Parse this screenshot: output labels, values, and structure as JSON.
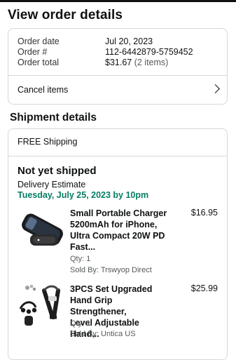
{
  "page": {
    "title": "View order details"
  },
  "order": {
    "date_label": "Order date",
    "date_value": "Jul 20, 2023",
    "number_label": "Order #",
    "number_value": "112-6442879-5759452",
    "total_label": "Order total",
    "total_value": "$31.67",
    "total_items": "(2 items)",
    "cancel_label": "Cancel items"
  },
  "shipment": {
    "section_title": "Shipment details",
    "shipping_method": "FREE Shipping",
    "status": "Not yet shipped",
    "estimate_label": "Delivery Estimate",
    "estimate_date": "Tuesday, July 25, 2023 by 10pm",
    "items": [
      {
        "title_lines": [
          "Small Portable Charger",
          "5200mAh for iPhone,",
          "Ultra Compact 20W PD",
          "Fast..."
        ],
        "price": "$16.95",
        "qty": "Qty: 1",
        "seller": "Sold By: Trswyop Direct",
        "image_icon": "portable-charger-image"
      },
      {
        "title_lines": [
          "3PCS Set Upgraded",
          "Hand Grip Strengthener,",
          "Level Adjustable Hand..."
        ],
        "price": "$25.99",
        "qty": "Qty: 1",
        "seller": "Sold By: Untica US",
        "image_icon": "hand-grip-image"
      }
    ]
  },
  "colors": {
    "delivery_green": "#067d62",
    "border": "#d5d9d9"
  }
}
